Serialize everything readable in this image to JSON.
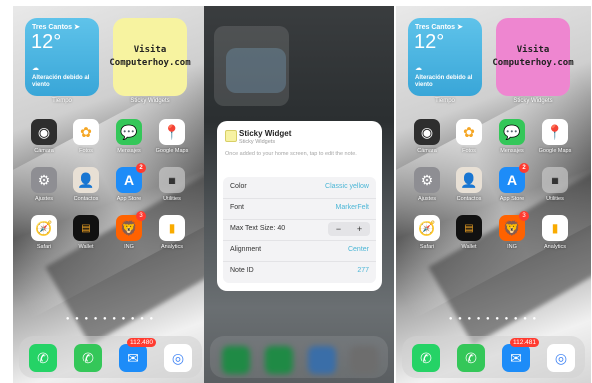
{
  "screens": [
    {
      "weather": {
        "location": "Tres Cantos ➤",
        "temp": "12°",
        "cloud_icon": "☁",
        "alert": "Alteración debido al viento",
        "label": "Tiempo"
      },
      "sticky": {
        "text": "Visita\nComputerhoy.com",
        "label": "Sticky Widgets",
        "color": "#f7f3a0"
      },
      "apps": [
        {
          "label": "Cámara",
          "icon": "camera-icon"
        },
        {
          "label": "Fotos",
          "icon": "photos-icon"
        },
        {
          "label": "Mensajes",
          "icon": "messages-icon"
        },
        {
          "label": "Google Maps",
          "icon": "google-maps-icon"
        },
        {
          "label": "Ajustes",
          "icon": "settings-icon"
        },
        {
          "label": "Contactos",
          "icon": "contacts-icon"
        },
        {
          "label": "App Store",
          "icon": "app-store-icon",
          "badge": "2"
        },
        {
          "label": "Utilities",
          "icon": "utilities-folder-icon"
        },
        {
          "label": "Safari",
          "icon": "safari-icon"
        },
        {
          "label": "Wallet",
          "icon": "wallet-icon"
        },
        {
          "label": "ING",
          "icon": "ing-icon",
          "badge": "3"
        },
        {
          "label": "Analytics",
          "icon": "analytics-icon"
        }
      ],
      "dock_mail_badge": "112.480"
    },
    {
      "sheet": {
        "title": "Sticky Widget",
        "subtitle": "Sticky Widgets",
        "description": "Once added to your home screen, tap to edit the note.",
        "rows": [
          {
            "key": "Color",
            "value": "Classic yellow"
          },
          {
            "key": "Font",
            "value": "MarkerFelt"
          },
          {
            "key": "Max Text Size: 40",
            "minus": "−",
            "plus": "+"
          },
          {
            "key": "Alignment",
            "value": "Center"
          },
          {
            "key": "Note ID",
            "value": "277"
          }
        ]
      }
    },
    {
      "weather": {
        "location": "Tres Cantos ➤",
        "temp": "12°",
        "cloud_icon": "☁",
        "alert": "Alteración debido al viento",
        "label": "Tiempo"
      },
      "sticky": {
        "text": "Visita\nComputerhoy.com",
        "label": "Sticky Widgets",
        "color": "#ee86d0"
      },
      "apps": [
        {
          "label": "Cámara",
          "icon": "camera-icon"
        },
        {
          "label": "Fotos",
          "icon": "photos-icon"
        },
        {
          "label": "Mensajes",
          "icon": "messages-icon"
        },
        {
          "label": "Google Maps",
          "icon": "google-maps-icon"
        },
        {
          "label": "Ajustes",
          "icon": "settings-icon"
        },
        {
          "label": "Contactos",
          "icon": "contacts-icon"
        },
        {
          "label": "App Store",
          "icon": "app-store-icon",
          "badge": "2"
        },
        {
          "label": "Utilities",
          "icon": "utilities-folder-icon"
        },
        {
          "label": "Safari",
          "icon": "safari-icon"
        },
        {
          "label": "Wallet",
          "icon": "wallet-icon"
        },
        {
          "label": "ING",
          "icon": "ing-icon",
          "badge": "3"
        },
        {
          "label": "Analytics",
          "icon": "analytics-icon"
        }
      ],
      "dock_mail_badge": "112.481"
    }
  ],
  "page_dots": "● ● ● ● ● ● ● ● ● ●"
}
